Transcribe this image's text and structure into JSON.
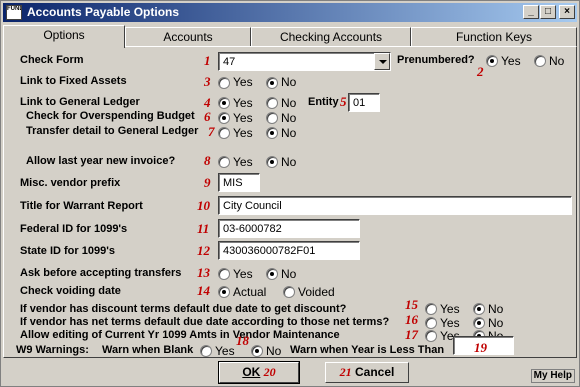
{
  "window": {
    "title": "Accounts Payable Options",
    "app_icon_text": "FUND",
    "minimize": "_",
    "maximize": "□",
    "close": "×"
  },
  "tabs": [
    "Options",
    "Accounts",
    "Checking Accounts",
    "Function Keys"
  ],
  "form": {
    "check_form": {
      "label": "Check Form",
      "num": "1",
      "value": "47"
    },
    "prenumbered": {
      "label": "Prenumbered?",
      "num": "2",
      "yes": "Yes",
      "no": "No",
      "selected": "yes"
    },
    "fixed_assets": {
      "label": "Link to Fixed Assets",
      "num": "3",
      "yes": "Yes",
      "no": "No",
      "selected": "no"
    },
    "general_ledger": {
      "label": "Link to General Ledger",
      "num": "4",
      "yes": "Yes",
      "no": "No",
      "selected": "yes"
    },
    "entity": {
      "label": "Entity",
      "num": "5",
      "value": "01"
    },
    "overspending": {
      "label": "Check for Overspending Budget",
      "num": "6",
      "yes": "Yes",
      "no": "No",
      "selected": "yes"
    },
    "transfer_detail": {
      "label": "Transfer detail to General Ledger",
      "num": "7",
      "yes": "Yes",
      "no": "No",
      "selected": "no"
    },
    "last_year_invoice": {
      "label": "Allow last year new invoice?",
      "num": "8",
      "yes": "Yes",
      "no": "No",
      "selected": "no"
    },
    "vendor_prefix": {
      "label": "Misc. vendor prefix",
      "num": "9",
      "value": "MIS"
    },
    "warrant_title": {
      "label": "Title for Warrant Report",
      "num": "10",
      "value": "City Council"
    },
    "federal_id": {
      "label": "Federal ID for 1099's",
      "num": "11",
      "value": "03-6000782"
    },
    "state_id": {
      "label": "State ID for 1099's",
      "num": "12",
      "value": "430036000782F01"
    },
    "ask_transfers": {
      "label": "Ask before accepting transfers",
      "num": "13",
      "yes": "Yes",
      "no": "No",
      "selected": "no"
    },
    "voiding_date": {
      "label": "Check voiding date",
      "num": "14",
      "actual": "Actual",
      "voided": "Voided",
      "selected": "actual"
    },
    "discount_terms": {
      "label": "If vendor has discount terms default due date to get discount?",
      "num": "15",
      "yes": "Yes",
      "no": "No",
      "selected": "no"
    },
    "net_terms": {
      "label": "If vendor has net terms default due date according to those net terms?",
      "num": "16",
      "yes": "Yes",
      "no": "No",
      "selected": "no"
    },
    "edit_1099": {
      "label": "Allow editing of Current Yr 1099 Amts in Vendor Maintenance",
      "num": "17",
      "yes": "Yes",
      "no": "No",
      "selected": "no"
    },
    "w9": {
      "label": "W9 Warnings:",
      "blank_label": "Warn when Blank",
      "num": "18",
      "yes": "Yes",
      "no": "No",
      "selected": "no",
      "year_label": "Warn when Year is Less Than",
      "year_num": "19",
      "year_value": ""
    }
  },
  "buttons": {
    "ok": "OK",
    "ok_num": "20",
    "cancel": "Cancel",
    "cancel_num": "21",
    "help": "My Help"
  }
}
